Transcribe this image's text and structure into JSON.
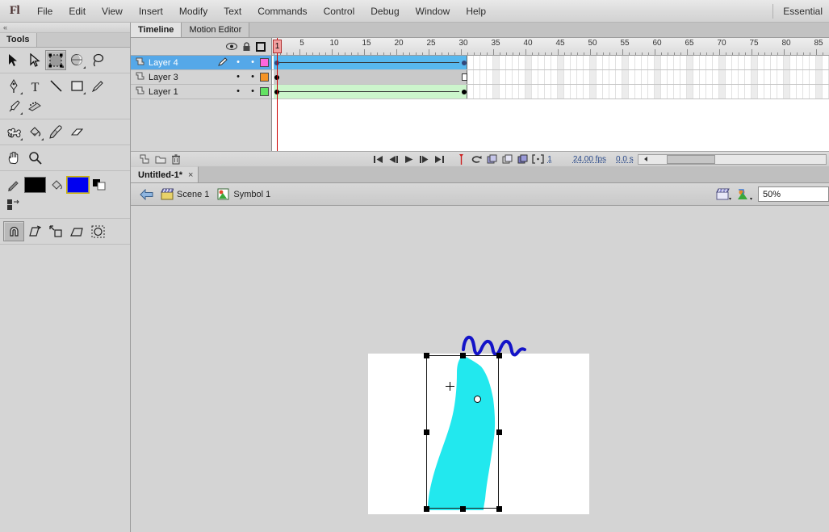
{
  "app": {
    "logo": "Fl",
    "menus": [
      "File",
      "Edit",
      "View",
      "Insert",
      "Modify",
      "Text",
      "Commands",
      "Control",
      "Debug",
      "Window",
      "Help"
    ],
    "workspace": "Essential"
  },
  "tools": {
    "panel_title": "Tools",
    "collapse_glyph": "«",
    "groups": [
      {
        "items": [
          {
            "name": "selection-tool",
            "glyph": "➤",
            "selected": false,
            "has_flyout": false
          },
          {
            "name": "subselection-tool",
            "glyph": "➤",
            "selected": false,
            "has_flyout": false
          },
          {
            "name": "free-transform-tool",
            "glyph": "⬚",
            "selected": true,
            "has_flyout": true
          },
          {
            "name": "gradient-transform-tool",
            "glyph": "◕",
            "selected": false,
            "has_flyout": true
          },
          {
            "name": "lasso-tool",
            "glyph": "⚲",
            "selected": false,
            "has_flyout": false
          }
        ]
      },
      {
        "items": [
          {
            "name": "pen-tool",
            "glyph": "✒",
            "selected": false,
            "has_flyout": true
          },
          {
            "name": "text-tool",
            "glyph": "T",
            "selected": false,
            "has_flyout": false
          },
          {
            "name": "line-tool",
            "glyph": "╲",
            "selected": false,
            "has_flyout": false
          },
          {
            "name": "rectangle-tool",
            "glyph": "□",
            "selected": false,
            "has_flyout": true
          },
          {
            "name": "pencil-tool",
            "glyph": "✎",
            "selected": false,
            "has_flyout": false
          },
          {
            "name": "brush-tool",
            "glyph": "὘c",
            "selected": false,
            "has_flyout": true
          },
          {
            "name": "deco-tool",
            "glyph": "⚘",
            "selected": false,
            "has_flyout": false
          }
        ]
      },
      {
        "items": [
          {
            "name": "bone-tool",
            "glyph": "☠",
            "selected": false,
            "has_flyout": true
          },
          {
            "name": "paint-bucket-tool",
            "glyph": "Ὗ3",
            "selected": false,
            "has_flyout": true
          },
          {
            "name": "eyedropper-tool",
            "glyph": "⚘",
            "selected": false,
            "has_flyout": false
          },
          {
            "name": "eraser-tool",
            "glyph": "▱",
            "selected": false,
            "has_flyout": false
          }
        ]
      },
      {
        "items": [
          {
            "name": "hand-tool",
            "glyph": "✋",
            "selected": false,
            "has_flyout": false
          },
          {
            "name": "zoom-tool",
            "glyph": "ὐd",
            "selected": false,
            "has_flyout": false
          }
        ]
      }
    ],
    "colors": {
      "stroke_label": "stroke-color",
      "stroke": "#000000",
      "fill_label": "fill-color",
      "fill": "#0000f0",
      "black": "#000000",
      "white": "#ffffff"
    },
    "options": [
      {
        "name": "snap-to-objects",
        "glyph": "∩",
        "selected": true
      },
      {
        "name": "rotate-and-skew",
        "glyph": "▱",
        "selected": false
      },
      {
        "name": "scale",
        "glyph": "⬌",
        "selected": false
      },
      {
        "name": "distort",
        "glyph": "▱",
        "selected": false
      },
      {
        "name": "envelope",
        "glyph": "○",
        "selected": false
      }
    ]
  },
  "timeline": {
    "tabs": [
      {
        "label": "Timeline",
        "active": true
      },
      {
        "label": "Motion Editor",
        "active": false
      }
    ],
    "header_icons": [
      {
        "name": "eye-icon",
        "glyph": "👁"
      },
      {
        "name": "lock-icon",
        "glyph": "🔒"
      },
      {
        "name": "outline-icon",
        "glyph": "□"
      }
    ],
    "current_frame": 1,
    "frame_width": 8,
    "total_frames": 87,
    "ruler_ticks": [
      1,
      5,
      10,
      15,
      20,
      25,
      30,
      35,
      40,
      45,
      50,
      55,
      60,
      65,
      70,
      75,
      80,
      85
    ],
    "layers": [
      {
        "name": "Layer 4",
        "color": "#ff66dd",
        "active": true,
        "pencil": true,
        "visible_dot": "•",
        "lock_dot": "•",
        "span_type": "motion-tween",
        "span_color": "#58b8ee",
        "span_start": 1,
        "span_end": 30,
        "end_keyframe": "filled"
      },
      {
        "name": "Layer 3",
        "color": "#f59426",
        "active": false,
        "pencil": false,
        "visible_dot": "•",
        "lock_dot": "•",
        "span_type": "static",
        "span_color": "#c9c9c9",
        "span_start": 1,
        "span_end": 30,
        "end_keyframe": "hollow"
      },
      {
        "name": "Layer 1",
        "color": "#63e263",
        "active": false,
        "pencil": false,
        "visible_dot": "•",
        "lock_dot": "•",
        "span_type": "shape-tween",
        "span_color": "#ccf5cc",
        "span_start": 1,
        "span_end": 30,
        "end_keyframe": "filled"
      }
    ],
    "layer_buttons": [
      {
        "name": "new-layer-button",
        "glyph": "⬚"
      },
      {
        "name": "new-folder-button",
        "glyph": "▱"
      },
      {
        "name": "delete-layer-button",
        "glyph": "🗑"
      }
    ],
    "playback_buttons": [
      {
        "name": "go-to-first-frame-button",
        "glyph": "⏮"
      },
      {
        "name": "step-back-one-frame-button",
        "glyph": "⏴"
      },
      {
        "name": "play-button",
        "glyph": "▶"
      },
      {
        "name": "step-forward-one-frame-button",
        "glyph": "⏵"
      },
      {
        "name": "go-to-last-frame-button",
        "glyph": "⏭"
      }
    ],
    "onion_buttons": [
      {
        "name": "center-frame-button",
        "glyph": "↕"
      },
      {
        "name": "loop-playback-button",
        "glyph": "↺"
      },
      {
        "name": "onion-skin-button",
        "glyph": "⧉"
      },
      {
        "name": "onion-skin-outlines-button",
        "glyph": "⧉"
      },
      {
        "name": "edit-multiple-frames-button",
        "glyph": "⧉"
      },
      {
        "name": "modify-onion-markers-button",
        "glyph": "[·]"
      }
    ],
    "status": {
      "frame": "1",
      "fps": "24.00 fps",
      "elapsed": "0.0 s"
    }
  },
  "document": {
    "tab_label": "Untitled-1*",
    "close_glyph": "×"
  },
  "editbar": {
    "back_arrow": "⇐",
    "crumbs": [
      {
        "label": "Scene 1",
        "icon": "scene-clapboard-icon"
      },
      {
        "label": "Symbol 1",
        "icon": "symbol-icon"
      }
    ],
    "edit_scene_icon": "edit-scene-icon",
    "edit_symbols_icon": "edit-symbols-icon",
    "zoom_value": "50%"
  },
  "stage": {
    "background": "#ffffff",
    "pasteboard": "#d4d4d4",
    "shapes": [
      {
        "name": "waterfall-shape",
        "fill": "#22e8ee",
        "description": "cyan waterfall / river shape"
      },
      {
        "name": "blue-wave-squiggle",
        "stroke": "#1414c8",
        "description": "blue wavy squiggle stroke above stage"
      }
    ],
    "selection": {
      "name": "free-transform-bounding-box",
      "handles": 8,
      "handle_color": "#000000",
      "registration_point": "registration-circle",
      "transform_point": "transform-cross"
    }
  }
}
